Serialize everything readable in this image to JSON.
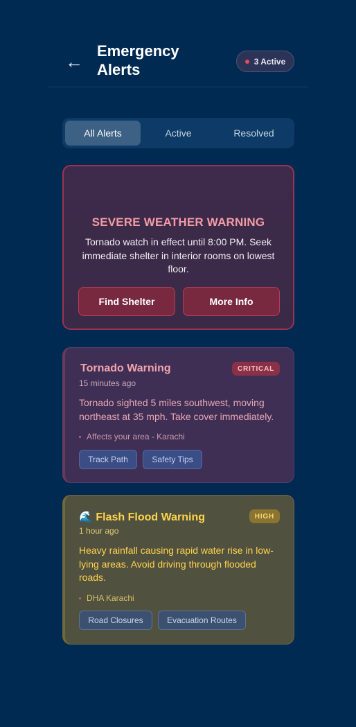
{
  "header": {
    "back_icon": "←",
    "title": "Emergency Alerts",
    "active_badge": "3 Active"
  },
  "tabs": [
    {
      "label": "All Alerts",
      "selected": true
    },
    {
      "label": "Active",
      "selected": false
    },
    {
      "label": "Resolved",
      "selected": false
    }
  ],
  "severe": {
    "title": "SEVERE WEATHER WARNING",
    "text": "Tornado watch in effect until 8:00 PM. Seek immediate shelter in interior rooms on lowest floor.",
    "buttons": [
      "Find Shelter",
      "More Info"
    ]
  },
  "alerts": [
    {
      "title": "Tornado Warning",
      "badge": "CRITICAL",
      "time": "15 minutes ago",
      "text": "Tornado sighted 5 miles southwest, moving northeast at 35 mph. Take cover immediately.",
      "affects": "Affects your area - Karachi",
      "actions": [
        "Track Path",
        "Safety Tips"
      ]
    },
    {
      "title": "🌊 Flash Flood Warning",
      "badge": "HIGH",
      "time": "1 hour ago",
      "text": "Heavy rainfall causing rapid water rise in low-lying areas. Avoid driving through flooded roads.",
      "affects": "DHA Karachi",
      "actions": [
        "Road Closures",
        "Evacuation Routes"
      ]
    }
  ],
  "colors": {
    "background": "#012a52",
    "critical": "#f4a3ad",
    "high": "#ffd54a"
  }
}
